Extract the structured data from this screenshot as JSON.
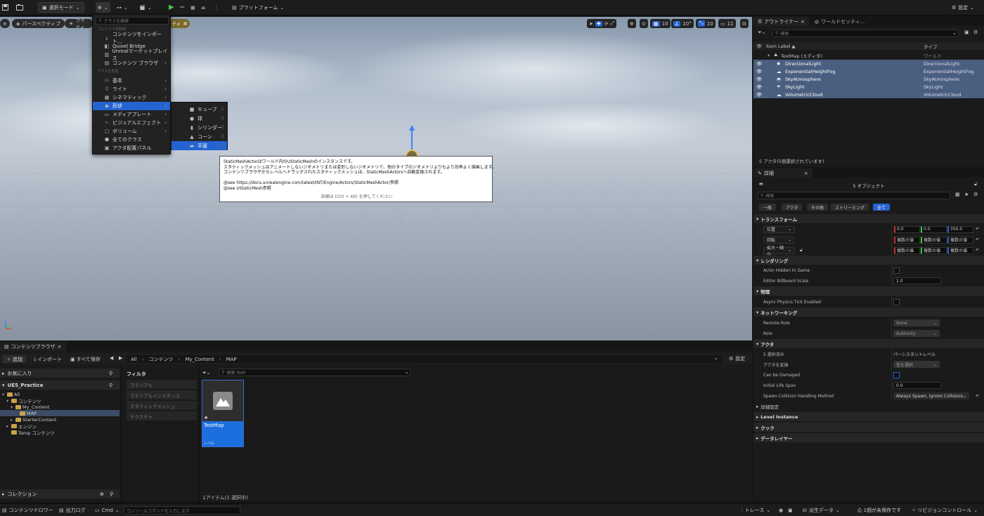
{
  "toolbar": {
    "mode_label": "選択モード",
    "platform_label": "プラットフォーム",
    "settings_label": "設定"
  },
  "viewport": {
    "perspective_label": "パースペクティブ",
    "lighting_label": "ライティ",
    "show_label": "ティ",
    "grid_snap": "10",
    "rot_snap": "10°",
    "scale_snap": "10",
    "camera_speed": "11"
  },
  "add_menu": {
    "search_placeholder": "クラスを検索",
    "section_content": "コンテンツを取得",
    "section_actor": "アクタを配置",
    "items_content": [
      {
        "icon": "import-icon",
        "label": "コンテンツをインポート..."
      },
      {
        "icon": "quixel-icon",
        "label": "Quixel Bridge"
      },
      {
        "icon": "marketplace-icon",
        "label": "Unrealマーケットプレイス"
      },
      {
        "icon": "content-browser-icon",
        "label": "コンテンツ ブラウザ"
      }
    ],
    "items_actor": [
      {
        "icon": "basic-icon",
        "label": "基本"
      },
      {
        "icon": "light-icon",
        "label": "ライト"
      },
      {
        "icon": "cinematic-icon",
        "label": "シネマティック"
      },
      {
        "icon": "shape-icon",
        "label": "形状"
      },
      {
        "icon": "media-icon",
        "label": "メディアプレート"
      },
      {
        "icon": "vfx-icon",
        "label": "ビジュアルエフェクト"
      },
      {
        "icon": "volume-icon",
        "label": "ボリューム"
      },
      {
        "icon": "all-classes-icon",
        "label": "全てのクラス"
      },
      {
        "icon": "placement-panel-icon",
        "label": "アクタ配置パネル"
      }
    ],
    "selected_index": 3
  },
  "shapes_submenu": {
    "items": [
      {
        "icon": "cube-icon",
        "label": "キューブ"
      },
      {
        "icon": "sphere-icon",
        "label": "球"
      },
      {
        "icon": "cylinder-icon",
        "label": "シリンダー"
      },
      {
        "icon": "cone-icon",
        "label": "コーン"
      },
      {
        "icon": "plane-icon",
        "label": "平面"
      }
    ],
    "selected_index": 4
  },
  "tooltip": {
    "lines": [
      "StaticMeshActorはワールド内のUStaticMeshのインスタンスです。",
      "スタティックメッシュはアニメートしないジオメトリまたは変形しないジオメトリで、他のタイプのジオメトリよりもより効率よく描画します。",
      "コンテンツブラウザからレベルへドラッグされたスタティックメッシュは、StaticMeshActorsへ自動変換されます。",
      "",
      "@see https://docs.unrealengine.com/latest/INT/Engine/Actors/StaticMeshActor/参照",
      "@see UStaticMesh参照"
    ],
    "hint": "詳細は (Ctrl + Alt) を押してください"
  },
  "outliner": {
    "tab_outliner": "アウトライナー",
    "tab_world": "ワールドセッティ...",
    "search_placeholder": "検索",
    "col_label": "Item Label ▲",
    "col_type": "タイプ",
    "map_label": "TestMap (エディタ)",
    "map_type": "ワールド",
    "actors": [
      {
        "icon": "directional-light-icon",
        "label": "DirectionalLight",
        "type": "DirectionalLight"
      },
      {
        "icon": "height-fog-icon",
        "label": "ExponentialHeightFog",
        "type": "ExponentialHeightFog"
      },
      {
        "icon": "sky-atmosphere-icon",
        "label": "SkyAtmosphere",
        "type": "SkyAtmosphere"
      },
      {
        "icon": "sky-light-icon",
        "label": "SkyLight",
        "type": "SkyLight"
      },
      {
        "icon": "volumetric-cloud-icon",
        "label": "VolumetricCloud",
        "type": "VolumetricCloud"
      }
    ],
    "status": "5 アクタ(5個選択されています)"
  },
  "details": {
    "tab_label": "詳細",
    "object_count": "5 オブジェクト",
    "search_placeholder": "検索",
    "filters": [
      "一般",
      "アクタ",
      "その他",
      "ストリーミング",
      "全て"
    ],
    "active_filter": 4,
    "sections": {
      "transform": "トランスフォーム",
      "rendering": "レンダリング",
      "physics": "物理",
      "networking": "ネットワーキング",
      "actor": "アクタ",
      "advanced": "詳細設定",
      "level_instance": "Level Instance",
      "cook": "クック",
      "data_layer": "データレイヤー"
    },
    "transform": {
      "location_label": "位置",
      "rotation_label": "回転",
      "scale_label": "拡大・縮小",
      "location": [
        "0.0",
        "0.0",
        "350.0"
      ],
      "rotation": [
        "複数の値",
        "複数の値",
        "複数の値"
      ],
      "scale": [
        "複数の値",
        "複数の値",
        "複数の値"
      ]
    },
    "rendering": {
      "hidden_label": "Actor Hidden In Game",
      "billboard_label": "Editor Billboard Scale",
      "billboard_value": "1.0"
    },
    "physics": {
      "async_label": "Async Physics Tick Enabled"
    },
    "networking": {
      "remote_role_label": "Remote Role",
      "remote_role_value": "None",
      "role_label": "Role",
      "role_value": "Authority"
    },
    "actor": {
      "selected_label": "5 選択済み",
      "selected_value": "パーシスタントレベル",
      "convert_label": "アクタを変換",
      "convert_value": "型を選択",
      "damaged_label": "Can be Damaged",
      "lifespan_label": "Initial Life Span",
      "lifespan_value": "0.0",
      "spawn_label": "Spawn Collision Handling Method",
      "spawn_value": "Always Spawn, Ignore Collisions"
    }
  },
  "content_browser": {
    "tab_label": "コンテンツブラウザ",
    "add_label": "追加",
    "import_label": "インポート",
    "save_all_label": "すべて保存",
    "breadcrumb": [
      "All",
      "コンテンツ",
      "My_Content",
      "MAP"
    ],
    "settings_label": "設定",
    "favorites_label": "お気に入り",
    "project_label": "UE5_Practice",
    "tree": [
      {
        "label": "All",
        "depth": 0
      },
      {
        "label": "コンテンツ",
        "depth": 1
      },
      {
        "label": "My_Content",
        "depth": 2
      },
      {
        "label": "MAP",
        "depth": 3
      },
      {
        "label": "StarterContent",
        "depth": 2
      },
      {
        "label": "エンジン",
        "depth": 1
      },
      {
        "label": "Temp コンテンツ",
        "depth": 1
      }
    ],
    "filter_header": "フィルタ",
    "filters": [
      "マテリアル",
      "マテリアルインスタンス",
      "スタティックメッシュ",
      "テクスチャ"
    ],
    "search_placeholder": "検索 MAP",
    "asset_name": "TestMap",
    "asset_type": "レベル",
    "item_count": "1アイテム(1 選択中)",
    "collections_label": "コレクション"
  },
  "status_bar": {
    "content_drawer": "コンテンツドロワー",
    "output_log": "出力ログ",
    "cmd": "Cmd",
    "console_placeholder": "コンソールコマンドを入力します",
    "trace": "トレース",
    "derived_data": "派生データ",
    "unsaved": "1個が未保存です",
    "revision_control": "リビジョンコントロール"
  },
  "colors": {
    "accent": "#2563d0",
    "selection": "#4a5f80"
  }
}
